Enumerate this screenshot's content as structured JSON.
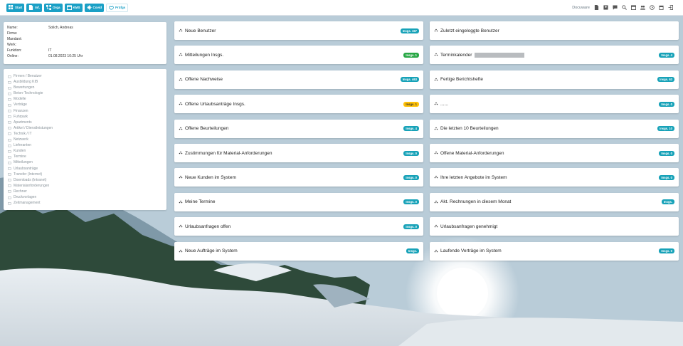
{
  "nav": [
    {
      "icon": "grid-icon",
      "label": "Start"
    },
    {
      "icon": "document-icon",
      "label": "Inf."
    },
    {
      "icon": "org-chart-icon",
      "label": "Orga"
    },
    {
      "icon": "calendar-icon",
      "label": "KMS"
    },
    {
      "icon": "virus-icon",
      "label": "Covid"
    },
    {
      "icon": "handshake-icon",
      "label": "Prüfgs"
    }
  ],
  "topbar": {
    "docuware_label": "Docuware",
    "icons": [
      "file-icon",
      "id-card-icon",
      "chat-icon",
      "search-icon",
      "calendar-icon",
      "users-icon",
      "clock-icon",
      "archive-icon",
      "logout-icon"
    ]
  },
  "userinfo": [
    {
      "key": "Name:",
      "value": "Solich, Andreas"
    },
    {
      "key": "Firma:",
      "value": ""
    },
    {
      "key": "Mandant:",
      "value": ""
    },
    {
      "key": "Werk:",
      "value": ""
    },
    {
      "key": "Funktion:",
      "value": "IT"
    },
    {
      "key": "Online:",
      "value": "01.08.2023 10:25 Uhr"
    }
  ],
  "menu": [
    "Firmen / Benutzer",
    "Ausbildung KIB",
    "Bewertungen",
    "Beton-Technologie",
    "Modelle",
    "Verträge",
    "Finanzen",
    "Fuhrpark",
    "Apartments",
    "Artikel / Dienstleistungen",
    "Technik / IT",
    "Netzwerk",
    "Lieferanten",
    "Kunden",
    "Termine",
    "Mitteilungen",
    "Urlaubsanträge",
    "Transfer (Internet)",
    "Downloads (Intranet)",
    "Materialanforderungen",
    "Rechner",
    "Druckvorlagen",
    "Zeitmanagement"
  ],
  "cards_left": [
    {
      "title": "Neue Benutzer",
      "badge": "Insgs. 157",
      "color": "#17a2b8"
    },
    {
      "title": "Mitteilungen Insgs.",
      "badge": "Insgs. 1",
      "color": "#28a745"
    },
    {
      "title": "Offene Nachweise",
      "badge": "Insgs. 463",
      "color": "#17a2b8"
    },
    {
      "title": "Offene Urlaubsanträge Insgs.",
      "badge": "Insgs. 1",
      "color": "#ffc107"
    },
    {
      "title": "Offene Beurteilungen",
      "badge": "Insgs. 4",
      "color": "#17a2b8"
    },
    {
      "title": "Zustimmungen für Material-Anforderungen",
      "badge": "Insgs. 0",
      "color": "#17a2b8"
    },
    {
      "title": "Neue Kunden im System",
      "badge": "Insgs. 0",
      "color": "#17a2b8"
    },
    {
      "title": "Meine Termine",
      "badge": "Insgs. 0",
      "color": "#17a2b8"
    },
    {
      "title": "Urlaubsanfragen offen",
      "badge": "Insgs. 0",
      "color": "#17a2b8"
    },
    {
      "title": "Neue Aufträge im System",
      "badge": "Insgs.",
      "color": "#17a2b8"
    }
  ],
  "cards_right": [
    {
      "title": "Zuletzt eingeloggte Benutzer",
      "badge": "",
      "color": "#17a2b8"
    },
    {
      "title": "Terminkalender",
      "badge": "Insgs. 4",
      "color": "#17a2b8",
      "redacted": true
    },
    {
      "title": "Fertige Berichtshefte",
      "badge": "Insgs. 63",
      "color": "#17a2b8"
    },
    {
      "title": "......",
      "badge": "Insgs. 0",
      "color": "#17a2b8"
    },
    {
      "title": "Die letzten 10 Beurteilungen",
      "badge": "Insgs. 10",
      "color": "#17a2b8"
    },
    {
      "title": "Offene Material-Anforderungen",
      "badge": "Insgs. 0",
      "color": "#17a2b8"
    },
    {
      "title": "Ihre letzten Angebote im System",
      "badge": "Insgs. 0",
      "color": "#17a2b8"
    },
    {
      "title": "Akt. Rechnungen in diesem Monat",
      "badge": "Insgs.",
      "color": "#17a2b8"
    },
    {
      "title": "Urlaubsanfragen genehmigt",
      "badge": "",
      "color": "#17a2b8"
    },
    {
      "title": "Laufende Verträge im System",
      "badge": "Insgs. 0",
      "color": "#17a2b8"
    }
  ]
}
